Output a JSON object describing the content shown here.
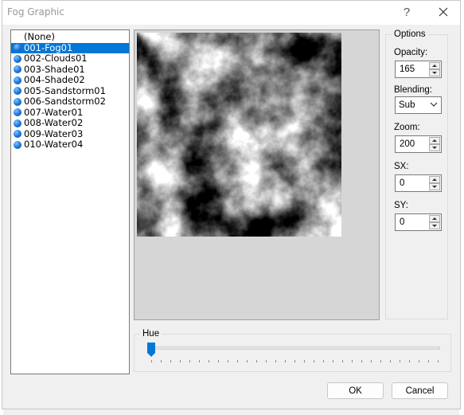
{
  "window": {
    "title": "Fog Graphic",
    "help_glyph": "?"
  },
  "list": {
    "items": [
      {
        "label": "(None)",
        "selected": false,
        "has_icon": false
      },
      {
        "label": "001-Fog01",
        "selected": true,
        "has_icon": true
      },
      {
        "label": "002-Clouds01",
        "selected": false,
        "has_icon": true
      },
      {
        "label": "003-Shade01",
        "selected": false,
        "has_icon": true
      },
      {
        "label": "004-Shade02",
        "selected": false,
        "has_icon": true
      },
      {
        "label": "005-Sandstorm01",
        "selected": false,
        "has_icon": true
      },
      {
        "label": "006-Sandstorm02",
        "selected": false,
        "has_icon": true
      },
      {
        "label": "007-Water01",
        "selected": false,
        "has_icon": true
      },
      {
        "label": "008-Water02",
        "selected": false,
        "has_icon": true
      },
      {
        "label": "009-Water03",
        "selected": false,
        "has_icon": true
      },
      {
        "label": "010-Water04",
        "selected": false,
        "has_icon": true
      }
    ],
    "selection_color": "#0078d7",
    "icon": "blue-orb-icon"
  },
  "options": {
    "group_label": "Options",
    "opacity": {
      "label": "Opacity:",
      "value": "165"
    },
    "blending": {
      "label": "Blending:",
      "value": "Sub"
    },
    "zoom": {
      "label": "Zoom:",
      "value": "200"
    },
    "sx": {
      "label": "SX:",
      "value": "0"
    },
    "sy": {
      "label": "SY:",
      "value": "0"
    }
  },
  "hue": {
    "label": "Hue",
    "value": 0,
    "thumb_color": "#0078d7"
  },
  "buttons": {
    "ok": "OK",
    "cancel": "Cancel"
  }
}
